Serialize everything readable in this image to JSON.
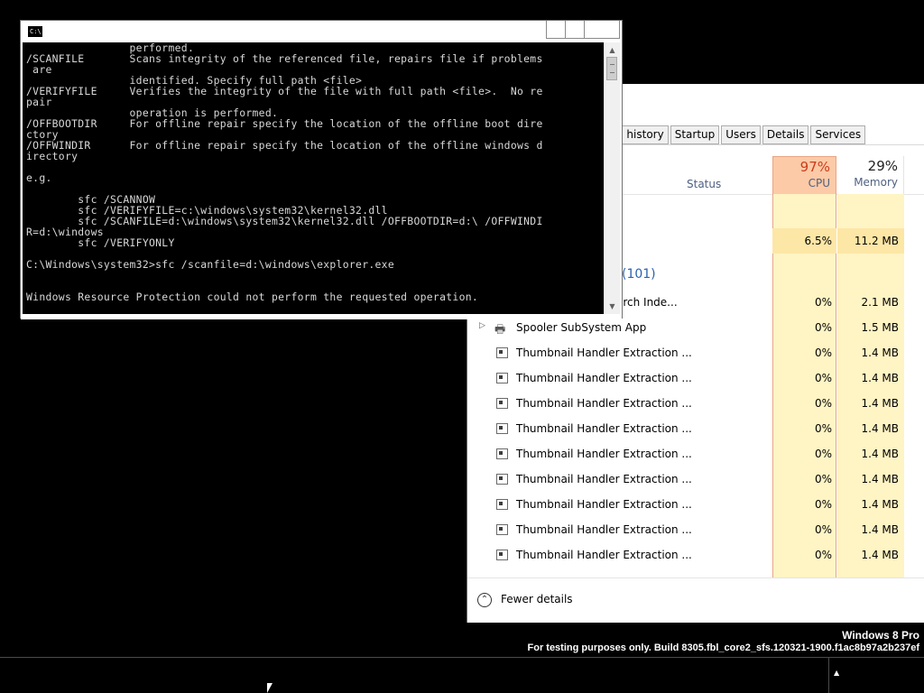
{
  "task_manager": {
    "tabs": [
      "p history",
      "Startup",
      "Users",
      "Details",
      "Services"
    ],
    "columns": {
      "status": "Status",
      "cpu_pct": "97%",
      "cpu_label": "CPU",
      "mem_pct": "29%",
      "mem_label": "Memory"
    },
    "group_row": {
      "cpu": "6.5%",
      "mem": "11.2 MB"
    },
    "bg_header": "(101)",
    "rows": [
      {
        "name": "arch Inde...",
        "cpu": "0%",
        "mem": "2.1 MB"
      },
      {
        "name": "Spooler SubSystem App",
        "cpu": "0%",
        "mem": "1.5 MB"
      },
      {
        "name": "Thumbnail Handler Extraction ...",
        "cpu": "0%",
        "mem": "1.4 MB"
      },
      {
        "name": "Thumbnail Handler Extraction ...",
        "cpu": "0%",
        "mem": "1.4 MB"
      },
      {
        "name": "Thumbnail Handler Extraction ...",
        "cpu": "0%",
        "mem": "1.4 MB"
      },
      {
        "name": "Thumbnail Handler Extraction ...",
        "cpu": "0%",
        "mem": "1.4 MB"
      },
      {
        "name": "Thumbnail Handler Extraction ...",
        "cpu": "0%",
        "mem": "1.4 MB"
      },
      {
        "name": "Thumbnail Handler Extraction ...",
        "cpu": "0%",
        "mem": "1.4 MB"
      },
      {
        "name": "Thumbnail Handler Extraction ...",
        "cpu": "0%",
        "mem": "1.4 MB"
      },
      {
        "name": "Thumbnail Handler Extraction ...",
        "cpu": "0%",
        "mem": "1.4 MB"
      },
      {
        "name": "Thumbnail Handler Extraction ...",
        "cpu": "0%",
        "mem": "1.4 MB"
      }
    ],
    "footer": {
      "fewer_details": "Fewer details"
    }
  },
  "cmd": {
    "icon_text": "C:\\.",
    "lines": [
      "                performed.",
      "/SCANFILE       Scans integrity of the referenced file, repairs file if problems",
      " are",
      "                identified. Specify full path <file>",
      "/VERIFYFILE     Verifies the integrity of the file with full path <file>.  No re",
      "pair",
      "                operation is performed.",
      "/OFFBOOTDIR     For offline repair specify the location of the offline boot dire",
      "ctory",
      "/OFFWINDIR      For offline repair specify the location of the offline windows d",
      "irectory",
      "",
      "e.g.",
      "",
      "        sfc /SCANNOW",
      "        sfc /VERIFYFILE=c:\\windows\\system32\\kernel32.dll",
      "        sfc /SCANFILE=d:\\windows\\system32\\kernel32.dll /OFFBOOTDIR=d:\\ /OFFWINDI",
      "R=d:\\windows",
      "        sfc /VERIFYONLY",
      "",
      "C:\\Windows\\system32>sfc /scanfile=d:\\windows\\explorer.exe",
      "",
      "",
      "Windows Resource Protection could not perform the requested operation."
    ]
  },
  "watermark": {
    "edition": "Windows 8 Pro",
    "build": "For testing purposes only. Build 8305.fbl_core2_sfs.120321-1900.f1ac8b97a2b237ef"
  },
  "colors": {
    "cpu_highlight": "#fccaa6",
    "cpu_header_text": "#cc3c1c",
    "cell_bg": "#fff4c4",
    "group_header": "#2b62b0"
  },
  "icons": {
    "cmd_app": "cmd-icon",
    "expand": "chevron-right-icon",
    "spooler": "printer-icon",
    "process": "app-window-icon",
    "fewer_details": "chevron-up-circle-icon",
    "tray": "chevron-up-icon"
  }
}
